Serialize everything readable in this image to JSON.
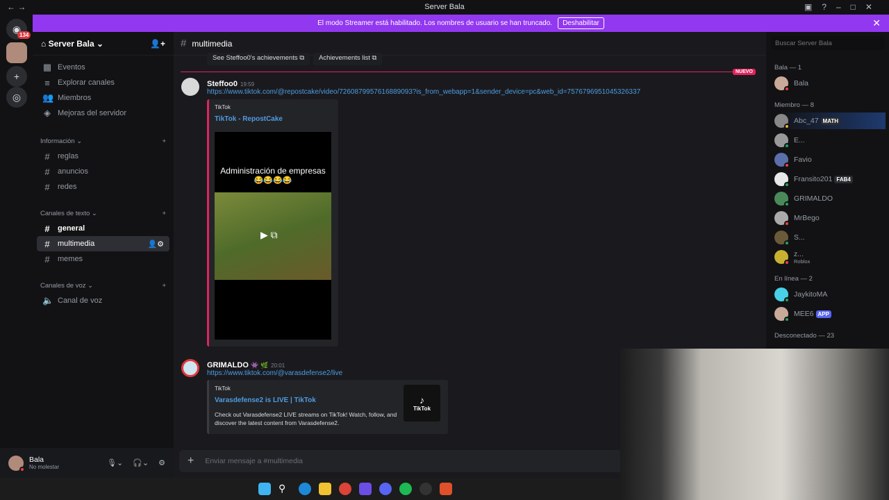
{
  "window": {
    "title": "Server Bala"
  },
  "banner": {
    "text": "El modo Streamer está habilitado. Los nombres de usuario se han truncado.",
    "button": "Deshabilitar"
  },
  "rail": {
    "badge": "134"
  },
  "server": {
    "name": "Server Bala"
  },
  "nav": [
    {
      "label": "Eventos",
      "icon": "calendar-icon"
    },
    {
      "label": "Explorar canales",
      "icon": "browse-icon"
    },
    {
      "label": "Miembros",
      "icon": "members-icon"
    },
    {
      "label": "Mejoras del servidor",
      "icon": "boost-icon"
    }
  ],
  "categories": [
    {
      "label": "Información",
      "channels": [
        "reglas",
        "anuncios",
        "redes"
      ]
    },
    {
      "label": "Canales de texto",
      "channels": [
        "general",
        "multimedia",
        "memes"
      ]
    },
    {
      "label": "Canales de voz",
      "channels": [
        "Canal de voz"
      ]
    }
  ],
  "user": {
    "name": "Bala",
    "status": "No molestar"
  },
  "channel": {
    "name": "multimedia"
  },
  "search": {
    "placeholder": "Buscar Server Bala"
  },
  "pills": [
    "See Steffoo0's achievements",
    "Achievements list"
  ],
  "new_label": "NUEVO",
  "messages": [
    {
      "author": "Steffoo0",
      "time": "19:59",
      "link": "https://www.tiktok.com/@repostcake/video/7260879957616889093?is_from_webapp=1&sender_device=pc&web_id=7576796951045326337",
      "embed": {
        "provider": "TikTok",
        "title": "TikTok - RepostCake",
        "video_caption": "Administración de empresas",
        "video_emoji": "😂😂😂😂"
      }
    },
    {
      "author": "GRIMALDO",
      "time": "20:01",
      "link": "https://www.tiktok.com/@varasdefense2/live",
      "embed": {
        "provider": "TikTok",
        "title": "Varasdefense2 is LIVE | TikTok",
        "description": "Check out Varasdefense2 LIVE streams on TikTok! Watch, follow, and discover the latest content from Varasdefense2.",
        "thumb": "TikTok"
      }
    }
  ],
  "composer": {
    "placeholder": "Enviar mensaje a #multimedia"
  },
  "members": {
    "groups": [
      {
        "header": "Bala — 1",
        "items": [
          {
            "name": "Bala",
            "status": "dnd"
          }
        ]
      },
      {
        "header": "Miembro — 8",
        "items": [
          {
            "name": "Abc_47",
            "tag": "MATH",
            "status": "idle"
          },
          {
            "name": "E...",
            "status": "online"
          },
          {
            "name": "Favio",
            "status": "dnd"
          },
          {
            "name": "Fransito201",
            "tag": "FAB4",
            "status": "online"
          },
          {
            "name": "GRIMALDO",
            "status": "online"
          },
          {
            "name": "MrBego",
            "status": "dnd"
          },
          {
            "name": "S...",
            "status": "mobile"
          },
          {
            "name": "z...",
            "activity": "Roblox",
            "status": "dnd"
          }
        ]
      },
      {
        "header": "En línea — 2",
        "items": [
          {
            "name": "JaykitoMA",
            "status": "online"
          },
          {
            "name": "MEE6",
            "tag": "APP",
            "status": "online"
          }
        ]
      },
      {
        "header": "Desconectado — 23",
        "items": []
      }
    ]
  },
  "colors": {
    "accent": "#9238f0",
    "link": "#4e9ce0",
    "online": "#23a55a",
    "dnd": "#f23f43",
    "idle": "#f0b232"
  }
}
